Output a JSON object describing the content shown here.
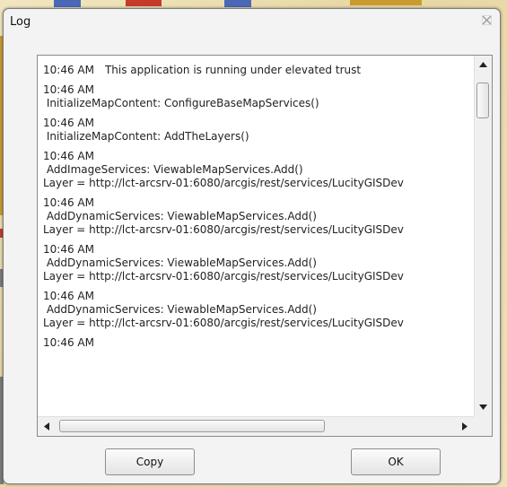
{
  "dialog": {
    "title": "Log",
    "close_icon": "close-icon"
  },
  "log": {
    "entries": [
      {
        "time": "10:46 AM",
        "lines": [
          "This application is running under elevated trust"
        ],
        "inline": true
      },
      {
        "time": "10:46 AM",
        "lines": [
          " InitializeMapContent: ConfigureBaseMapServices()"
        ],
        "inline": false
      },
      {
        "time": "10:46 AM",
        "lines": [
          " InitializeMapContent: AddTheLayers()"
        ],
        "inline": false
      },
      {
        "time": "10:46 AM",
        "lines": [
          " AddImageServices: ViewableMapServices.Add()",
          "Layer = http://lct-arcsrv-01:6080/arcgis/rest/services/LucityGISDev"
        ],
        "inline": false
      },
      {
        "time": "10:46 AM",
        "lines": [
          " AddDynamicServices: ViewableMapServices.Add()",
          "Layer = http://lct-arcsrv-01:6080/arcgis/rest/services/LucityGISDev"
        ],
        "inline": false
      },
      {
        "time": "10:46 AM",
        "lines": [
          " AddDynamicServices: ViewableMapServices.Add()",
          "Layer = http://lct-arcsrv-01:6080/arcgis/rest/services/LucityGISDev"
        ],
        "inline": false
      },
      {
        "time": "10:46 AM",
        "lines": [
          " AddDynamicServices: ViewableMapServices.Add()",
          "Layer = http://lct-arcsrv-01:6080/arcgis/rest/services/LucityGISDev"
        ],
        "inline": false
      },
      {
        "time": "10:46 AM",
        "lines": [],
        "inline": false
      }
    ]
  },
  "scrollbars": {
    "up_icon": "arrow-up-icon",
    "down_icon": "arrow-down-icon",
    "left_icon": "arrow-left-icon",
    "right_icon": "arrow-right-icon"
  },
  "buttons": {
    "copy_label": "Copy",
    "ok_label": "OK"
  },
  "colors": {
    "dialog_bg": "#f3f3f3",
    "log_bg": "#ffffff",
    "text": "#222222"
  }
}
